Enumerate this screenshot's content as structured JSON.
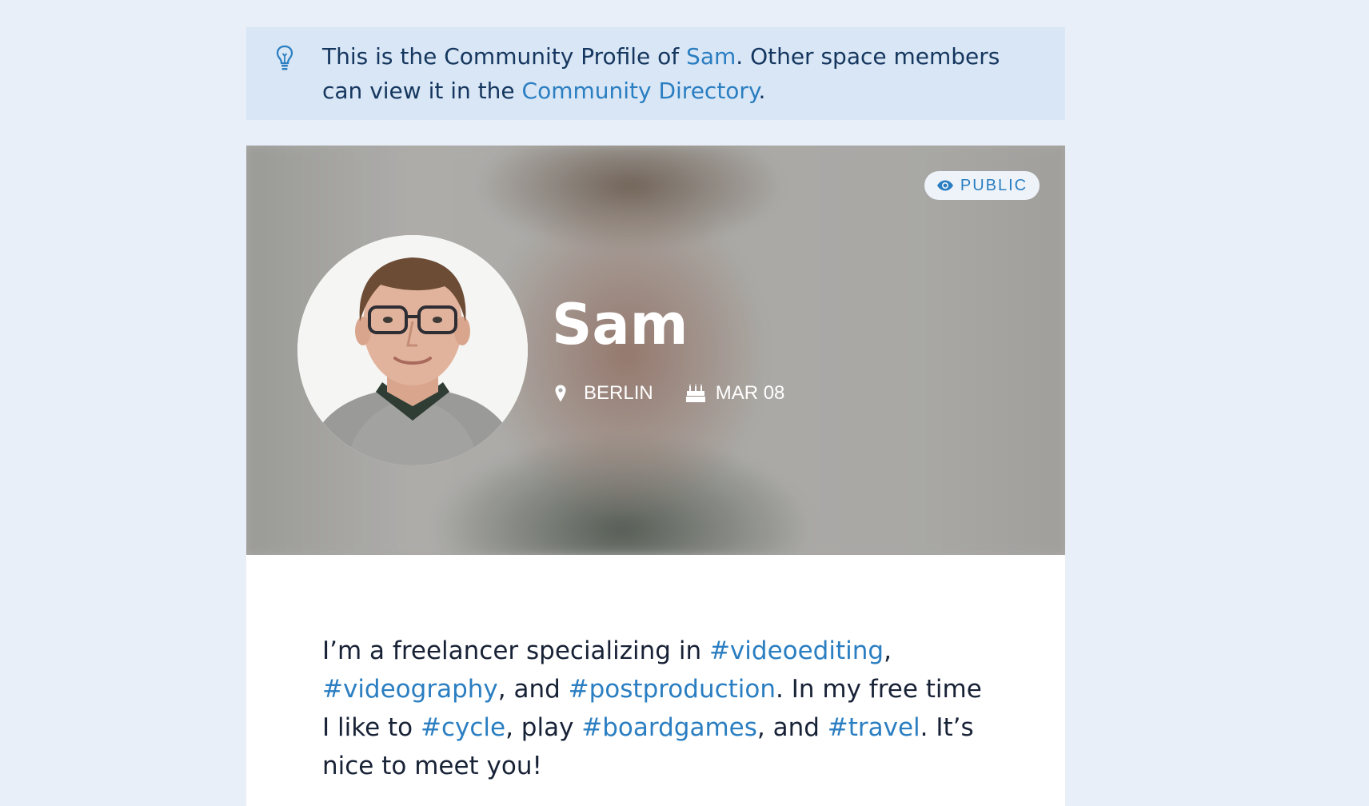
{
  "banner": {
    "text_prefix": "This is the Community Profile of ",
    "name_link": "Sam",
    "text_middle": ". Other space members can view it in the ",
    "directory_link": "Community Directory",
    "text_suffix": "."
  },
  "profile": {
    "visibility_label": "PUBLIC",
    "name": "Sam",
    "location": "BERLIN",
    "birthday": "MAR 08"
  },
  "bio": {
    "p1": "I’m a freelancer specializing in ",
    "tag1": "#videoediting",
    "p2": ", ",
    "tag2": "#videography",
    "p3": ", and ",
    "tag3": "#postproduction",
    "p4": ". In my free time I like to ",
    "tag4": "#cycle",
    "p5": ", play ",
    "tag5": "#boardgames",
    "p6": ", and ",
    "tag6": "#travel",
    "p7": ". It’s nice to meet you!"
  },
  "colors": {
    "page_background": "#e9eff8",
    "banner_background": "#d8e6f5",
    "link": "#2a7ec1",
    "text": "#182236"
  },
  "icons": {
    "banner": "lightbulb-icon",
    "visibility": "eye-icon",
    "location": "map-pin-icon",
    "birthday": "birthday-cake-icon"
  }
}
